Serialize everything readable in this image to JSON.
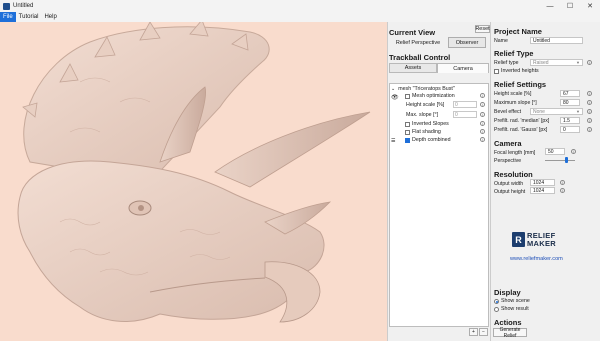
{
  "window": {
    "title": "Untitled",
    "controls": {
      "minimize": "—",
      "maximize": "☐",
      "close": "✕"
    }
  },
  "menu": {
    "items": [
      {
        "label": "File",
        "active": true
      },
      {
        "label": "Tutorial",
        "active": false
      },
      {
        "label": "Help",
        "active": false
      }
    ]
  },
  "current_view": {
    "title": "Current View",
    "reset_label": "Reset",
    "relief_perspective_label": "Relief Perspective",
    "observer_label": "Observer"
  },
  "trackball": {
    "title": "Trackball Control",
    "tabs": [
      {
        "label": "Assets",
        "active": false
      },
      {
        "label": "Camera",
        "active": true
      }
    ]
  },
  "asset": {
    "mesh_name": "mesh \"Triceratops Bust\"",
    "mesh_optimization_label": "Mesh optimization",
    "mesh_optimization_checked": false,
    "height_scale_label": "Height scale [%]",
    "height_scale_value": "0",
    "max_slope_label": "Max. slope [°]",
    "max_slope_value": "0",
    "inverted_slopes_label": "Inverted Slopes",
    "inverted_slopes_checked": false,
    "flat_shading_label": "Flat shading",
    "flat_shading_checked": false,
    "depth_combined_label": "Depth combined",
    "depth_combined_checked": true
  },
  "project": {
    "title": "Project Name",
    "name_label": "Name",
    "name_value": "Untitled"
  },
  "relief_type": {
    "title": "Relief Type",
    "label": "Relief type",
    "value": "Raised",
    "inverted_heights_label": "Inverted heights",
    "inverted_heights_checked": false
  },
  "relief_settings": {
    "title": "Relief Settings",
    "height_scale_label": "Height scale [%]",
    "height_scale_value": "67",
    "max_slope_label": "Maximum slope [°]",
    "max_slope_value": "80",
    "bevel_label": "Bevel effect",
    "bevel_value": "None",
    "prefilt_median_label": "Prefilt. rad. 'median' [px]",
    "prefilt_median_value": "1.5",
    "prefilt_gauss_label": "Prefilt. rad. 'Gauss' [px]",
    "prefilt_gauss_value": "0"
  },
  "camera": {
    "title": "Camera",
    "focal_label": "Focal length [mm]",
    "focal_value": "50",
    "perspective_label": "Perspective",
    "perspective_level": 0.7
  },
  "resolution": {
    "title": "Resolution",
    "width_label": "Output width",
    "width_value": "1024",
    "height_label": "Output height",
    "height_value": "1024"
  },
  "branding": {
    "logo_line1": "RELIEF",
    "logo_line2": "MAKER",
    "url": "www.reliefmaker.com"
  },
  "display": {
    "title": "Display",
    "show_scene_label": "Show scene",
    "show_scene_selected": true,
    "show_result_label": "Show result",
    "show_result_selected": false
  },
  "actions": {
    "title": "Actions",
    "generate_label": "Generate Relief"
  },
  "colors": {
    "viewport_bg": "#f9dccd",
    "relief_surface": "#efd6c9",
    "accent": "#1e6fd9"
  }
}
